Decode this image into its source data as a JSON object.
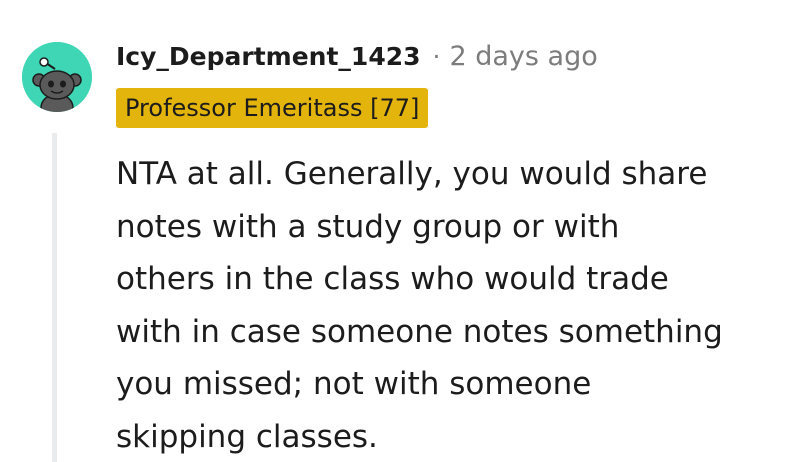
{
  "comment": {
    "avatar_icon": "reddit-snoo-icon",
    "avatar_color": "#3ed6b5",
    "username": "Icy_Department_1423",
    "separator": "·",
    "timestamp": "2 days ago",
    "flair": "Professor Emeritass [77]",
    "flair_color": "#e3b40c",
    "body_lines": [
      "NTA at all. Generally, you would share",
      "notes with a study group or with",
      "others in the class who would trade",
      "with in case someone notes something",
      "you missed; not with someone",
      "skipping classes."
    ]
  }
}
